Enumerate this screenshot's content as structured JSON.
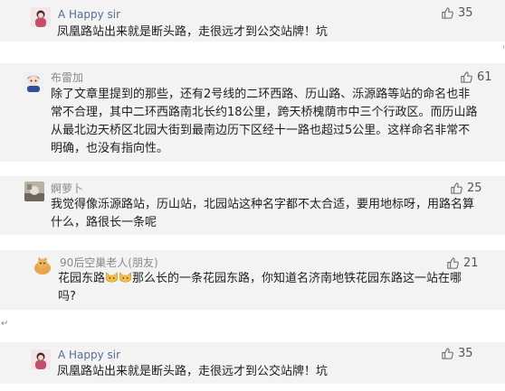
{
  "comments": [
    {
      "user": "A Happy sir",
      "likes": "35",
      "lines": [
        "凤凰路站出来就是断头路，走很远才到公交站牌！坑"
      ]
    },
    {
      "user": "布雷加",
      "likes": "61",
      "lines": [
        "除了文章里提到的那些，还有2号线的二环西路、历山路、泺源路等站的命名也非",
        "常不合理，其中二环西路南北长约18公里，跨天桥槐荫市中三个行政区。而历山路",
        "从最北边天桥区北园大街到最南边历下区经十一路也超过5公里。这样命名非常不",
        "明确，也没有指向性。"
      ]
    },
    {
      "user": "婀萝卜",
      "likes": "25",
      "lines": [
        "我觉得像泺源路站，历山站，北园站这种名字都不太合适，要用地标呀，用路名算",
        "什么，路很长一条呢"
      ]
    },
    {
      "user": "90后空巢老人(朋友)",
      "likes": "21",
      "line1_a": "花园东路",
      "line1_b": "那么长的一条花园东路，你知道名济南地铁花园东路这一站在哪",
      "line2": "吗?"
    },
    {
      "user": "A Happy sir",
      "likes": "35",
      "lines": [
        "凤凰路站出来就是断头路，走很远才到公交站牌！坑"
      ]
    }
  ],
  "icons": {
    "like": "thumbs-up-icon",
    "emoji": "cat-face-emoji-icon",
    "paragraph": "return-mark-icon"
  },
  "paragraph_mark": "↵",
  "colors": {
    "card_bg": "#f3f3f3",
    "username_blue": "#566c93",
    "username_gray": "#8a8a8a"
  }
}
